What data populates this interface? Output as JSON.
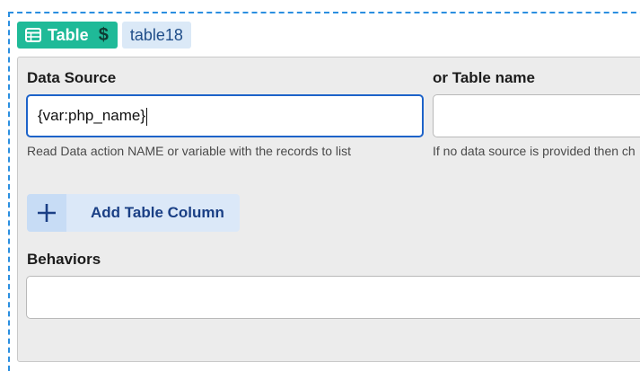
{
  "tags": {
    "type_label": "Table",
    "type_icon": "table-icon",
    "type_suffix": "$",
    "id_label": "table18"
  },
  "data_source": {
    "label": "Data Source",
    "value": "{var:php_name}",
    "help": "Read Data action NAME or variable with the records to list"
  },
  "table_name": {
    "label": "or Table name",
    "value": "",
    "help": "If no data source is provided then ch"
  },
  "add_column": {
    "icon": "plus-icon",
    "label": "Add Table Column"
  },
  "behaviors": {
    "label": "Behaviors",
    "value": ""
  },
  "colors": {
    "accent": "#1fba98",
    "frame": "#2b8fe0",
    "focus": "#1d63c9",
    "button_text": "#1a3f85"
  }
}
